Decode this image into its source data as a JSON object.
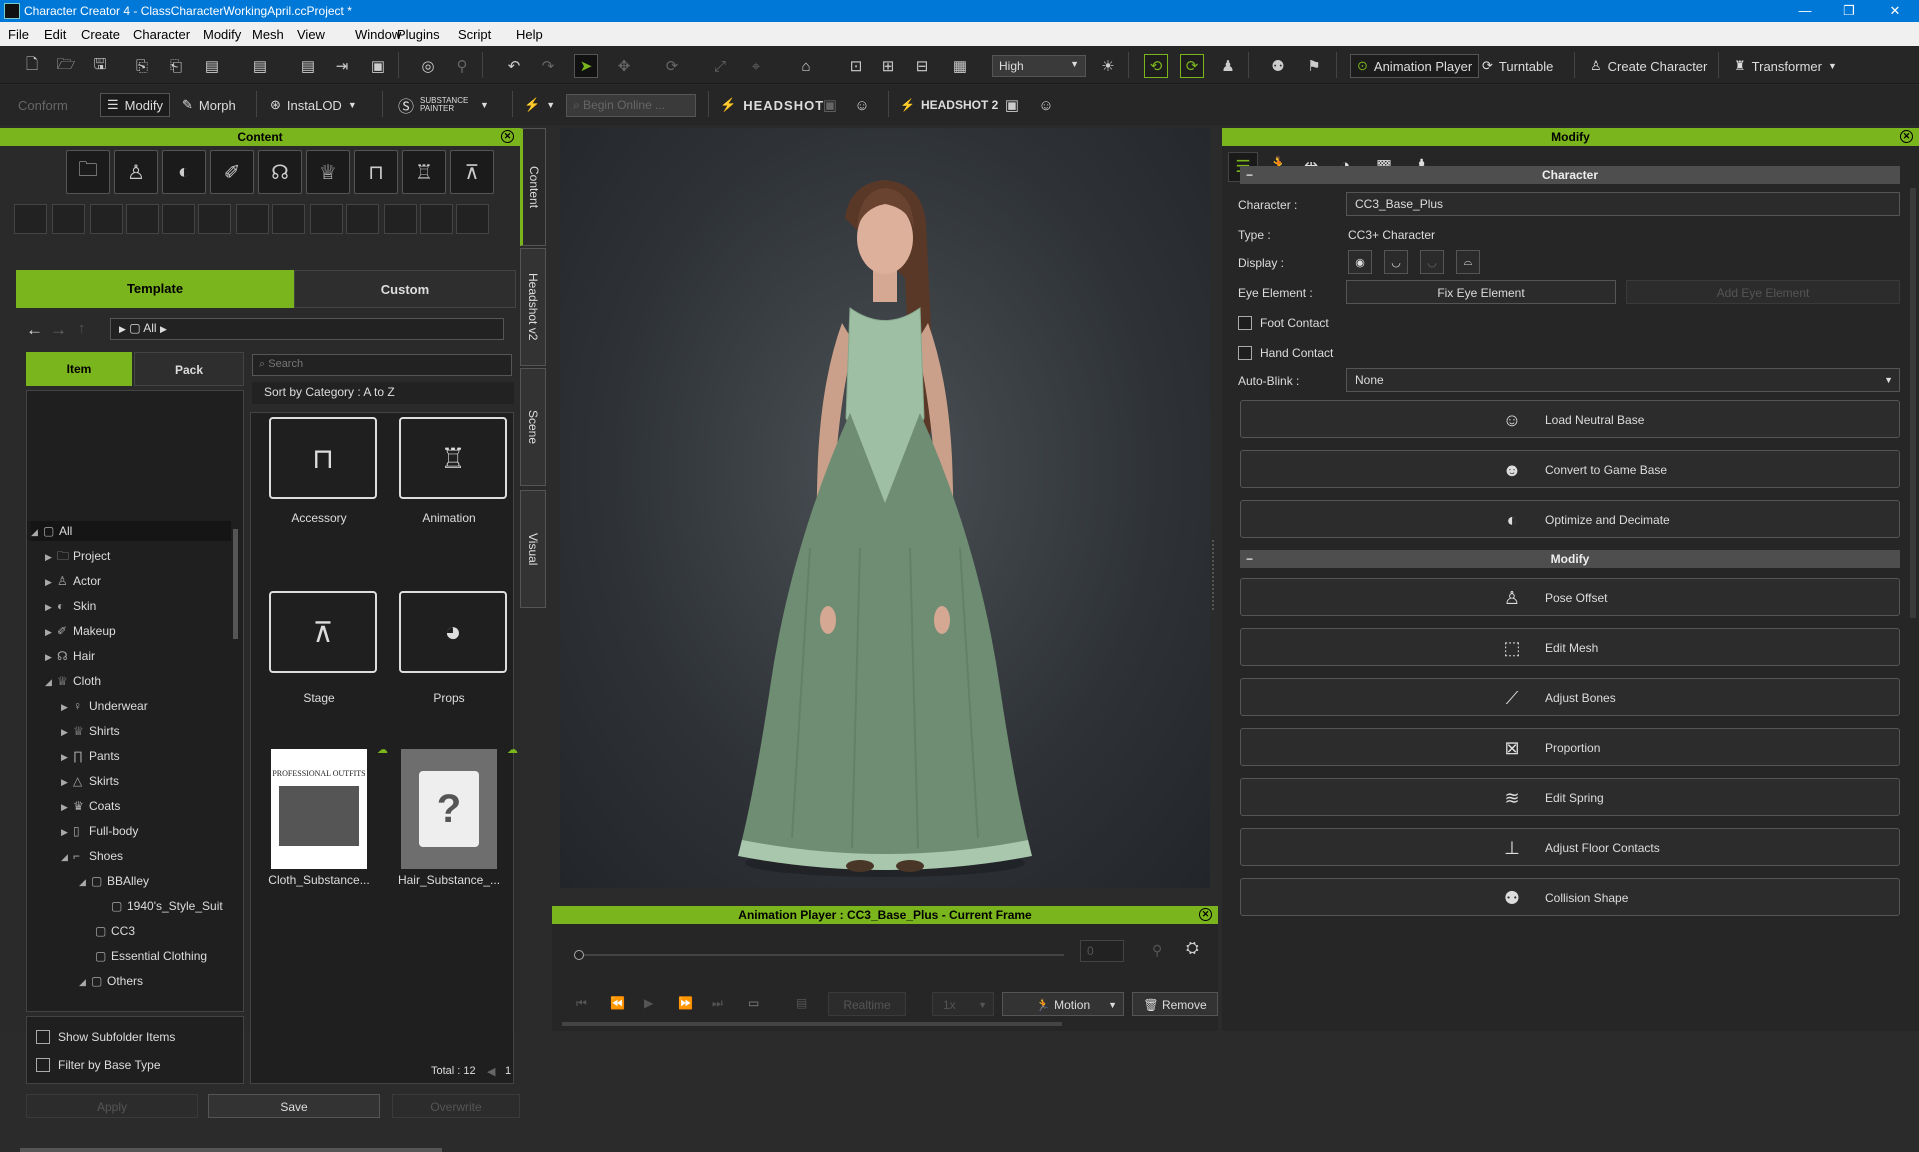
{
  "window": {
    "title": "Character Creator 4 - ClassCharacterWorkingApril.ccProject *"
  },
  "menu": [
    "File",
    "Edit",
    "Create",
    "Character",
    "Modify",
    "Mesh",
    "View",
    "Window",
    "Plugins",
    "Script",
    "Help"
  ],
  "toolbar1": {
    "quality": "High",
    "animation_player": "Animation Player",
    "turntable": "Turntable",
    "create_character": "Create Character",
    "transformer": "Transformer"
  },
  "toolbar2": {
    "conform": "Conform",
    "modify": "Modify",
    "morph": "Morph",
    "instalod": "InstaLOD",
    "substance": "SUBSTANCE PAINTER",
    "begin_online": "Begin Online ...",
    "headshot": "HEADSHOT",
    "headshot2": "HEADSHOT 2"
  },
  "content": {
    "title": "Content",
    "tabs": {
      "template": "Template",
      "custom": "Custom"
    },
    "path": "All",
    "subtabs": {
      "item": "Item",
      "pack": "Pack"
    },
    "search_placeholder": "Search",
    "sort": "Sort by Category : A to Z",
    "tree": [
      "All",
      "Project",
      "Actor",
      "Skin",
      "Makeup",
      "Hair",
      "Cloth",
      "Underwear",
      "Shirts",
      "Pants",
      "Skirts",
      "Coats",
      "Full-body",
      "Shoes",
      "BBAlley",
      "1940's_Style_Suit",
      "CC3",
      "Essential Clothing",
      "Others"
    ],
    "items": [
      "Accessory",
      "Animation",
      "Stage",
      "Props",
      "Cloth_Substance...",
      "Hair_Substance_..."
    ],
    "thumb_text": "PROFESSIONAL OUTFITS",
    "show_subfolder": "Show Subfolder Items",
    "filter_base": "Filter by Base Type",
    "total": "Total : 12",
    "page": "1",
    "buttons": {
      "apply": "Apply",
      "save": "Save",
      "overwrite": "Overwrite"
    },
    "side_tabs": [
      "Content",
      "Headshot v2",
      "Scene",
      "Visual"
    ]
  },
  "anim": {
    "title": "Animation Player : CC3_Base_Plus - Current Frame",
    "frame": "0",
    "realtime": "Realtime",
    "speed": "1x",
    "motion": "Motion",
    "remove": "Remove"
  },
  "modify": {
    "title": "Modify",
    "section_character": "Character",
    "character_label": "Character :",
    "character_value": "CC3_Base_Plus",
    "type_label": "Type :",
    "type_value": "CC3+ Character",
    "display_label": "Display :",
    "eye_label": "Eye Element :",
    "fix_eye": "Fix Eye Element",
    "add_eye": "Add Eye Element",
    "foot_contact": "Foot Contact",
    "hand_contact": "Hand Contact",
    "autoblink_label": "Auto-Blink :",
    "autoblink_value": "None",
    "char_buttons": [
      "Load Neutral Base",
      "Convert to Game Base",
      "Optimize and Decimate"
    ],
    "section_modify": "Modify",
    "modify_buttons": [
      "Pose Offset",
      "Edit Mesh",
      "Adjust Bones",
      "Proportion",
      "Edit Spring",
      "Adjust Floor Contacts",
      "Collision Shape"
    ]
  },
  "colors": {
    "accent": "#7ab51d",
    "titlebar": "#0078d7"
  }
}
